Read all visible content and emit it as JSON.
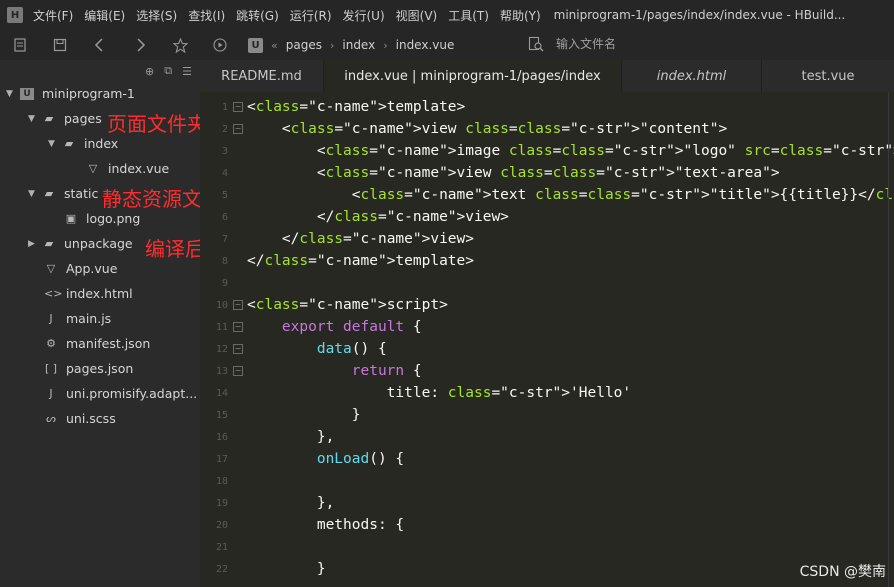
{
  "menubar": {
    "items": [
      "文件(F)",
      "编辑(E)",
      "选择(S)",
      "查找(I)",
      "跳转(G)",
      "运行(R)",
      "发行(U)",
      "视图(V)",
      "工具(T)",
      "帮助(Y)"
    ],
    "title": "miniprogram-1/pages/index/index.vue - HBuild..."
  },
  "toolbar": {
    "breadcrumb": [
      "pages",
      "index",
      "index.vue"
    ],
    "search_placeholder": "输入文件名"
  },
  "sidebar": {
    "tree": [
      {
        "label": "miniprogram-1",
        "icon": "project-icon",
        "arrow": "expanded"
      },
      {
        "label": "pages",
        "icon": "folder-icon",
        "arrow": "expanded"
      },
      {
        "label": "index",
        "icon": "folder-icon",
        "arrow": "expanded"
      },
      {
        "label": "index.vue",
        "icon": "vue-file-icon",
        "arrow": ""
      },
      {
        "label": "static",
        "icon": "folder-icon",
        "arrow": "expanded"
      },
      {
        "label": "logo.png",
        "icon": "image-file-icon",
        "arrow": ""
      },
      {
        "label": "unpackage",
        "icon": "folder-icon",
        "arrow": "collapsed"
      },
      {
        "label": "App.vue",
        "icon": "vue-file-icon",
        "arrow": ""
      },
      {
        "label": "index.html",
        "icon": "html-file-icon",
        "arrow": ""
      },
      {
        "label": "main.js",
        "icon": "js-file-icon",
        "arrow": ""
      },
      {
        "label": "manifest.json",
        "icon": "json-file-icon",
        "arrow": ""
      },
      {
        "label": "pages.json",
        "icon": "json-file-icon",
        "arrow": ""
      },
      {
        "label": "uni.promisify.adapt...",
        "icon": "js-file-icon",
        "arrow": ""
      },
      {
        "label": "uni.scss",
        "icon": "scss-file-icon",
        "arrow": ""
      }
    ]
  },
  "annotations": {
    "pages": "页面文件夹",
    "static": "静态资源文件夹",
    "unpackage": "编译后小程序资源文件夹"
  },
  "tabs": [
    {
      "label": "README.md",
      "active": false
    },
    {
      "label": "index.vue | miniprogram-1/pages/index",
      "active": true
    },
    {
      "label": "index.html",
      "active": false
    },
    {
      "label": "test.vue",
      "active": false
    }
  ],
  "editor": {
    "line_numbers": [
      "1",
      "2",
      "3",
      "4",
      "5",
      "6",
      "7",
      "8",
      "9",
      "10",
      "11",
      "12",
      "13",
      "14",
      "15",
      "16",
      "17",
      "18",
      "19",
      "20",
      "21",
      "22"
    ],
    "code": [
      "<template>",
      "    <view class=\"content\">",
      "        <image class=\"logo\" src=\"/static/logo.png\"></image>",
      "        <view class=\"text-area\">",
      "            <text class=\"title\">{{title}}</text>",
      "        </view>",
      "    </view>",
      "</template>",
      "",
      "<script>",
      "    export default {",
      "        data() {",
      "            return {",
      "                title: 'Hello'",
      "            }",
      "        },",
      "        onLoad() {",
      "",
      "        },",
      "        methods: {",
      "",
      "        }"
    ]
  },
  "watermark": "CSDN @樊南"
}
